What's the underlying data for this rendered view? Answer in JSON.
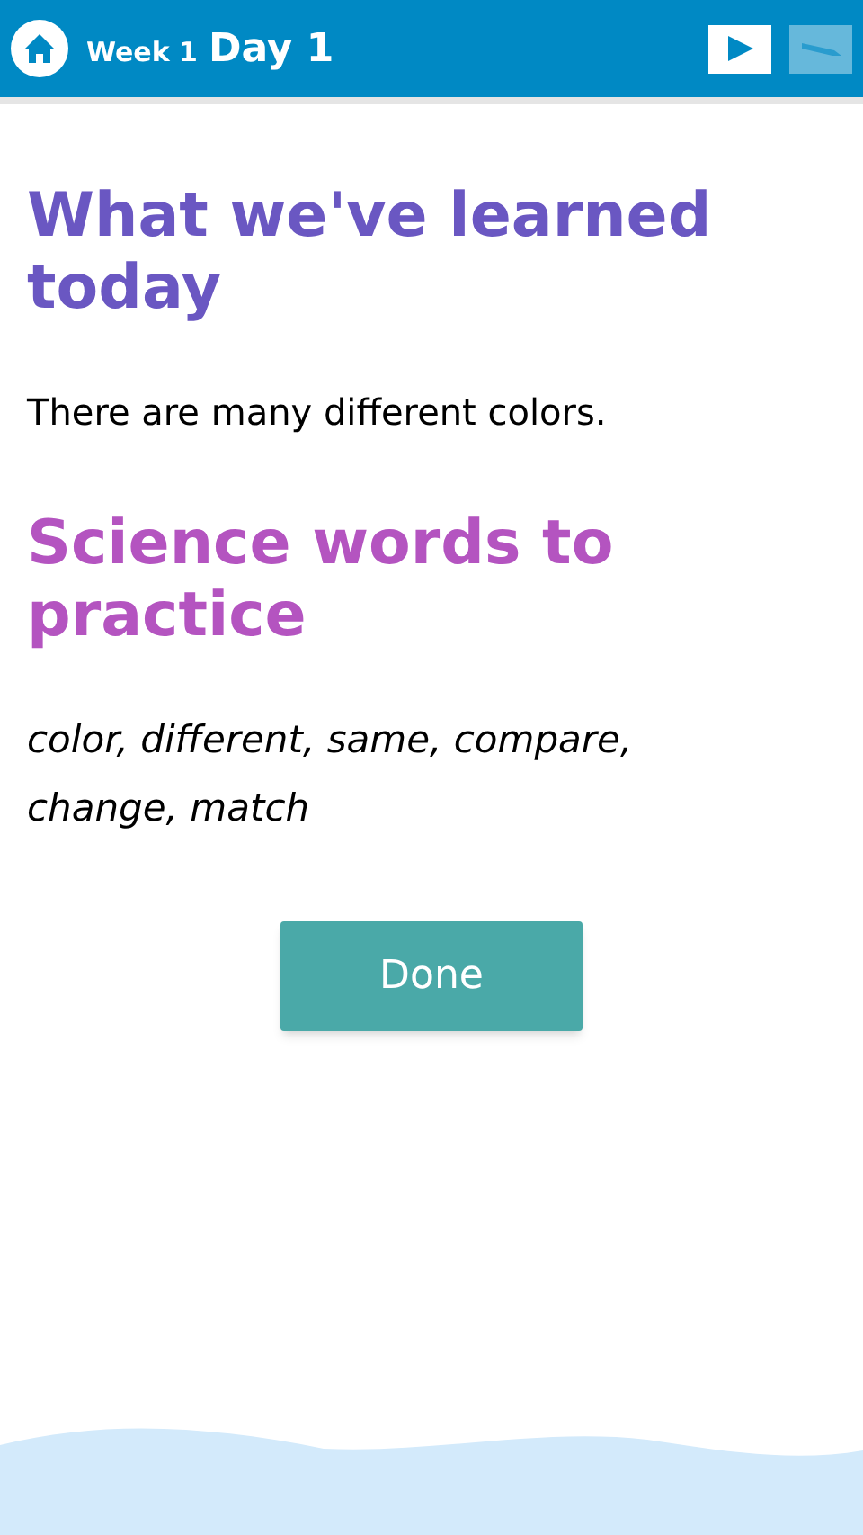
{
  "header": {
    "week": "Week 1",
    "day": "Day 1",
    "play_button": {
      "disabled": false
    },
    "pencil_button": {
      "disabled": true
    }
  },
  "sections": [
    {
      "kind": "heading",
      "text": "What we've learned today",
      "color": "#6a57c2"
    },
    {
      "kind": "paragraph",
      "text": "There are many different colors."
    },
    {
      "kind": "heading",
      "text": "Science words to practice",
      "color": "#b454c0"
    },
    {
      "kind": "words",
      "text": "color, different, same, compare, change, match"
    }
  ],
  "button": {
    "label": "Done"
  }
}
